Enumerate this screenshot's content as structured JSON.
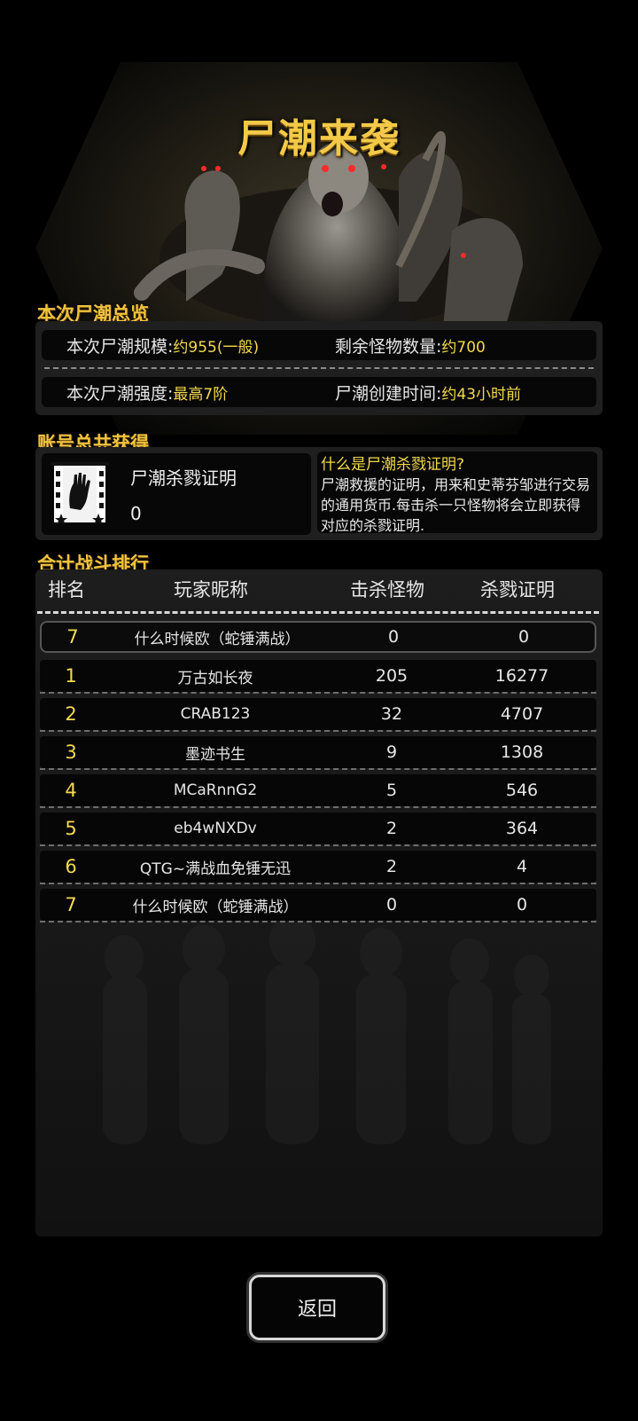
{
  "title": "尸潮来袭",
  "overview": {
    "label": "本次尸潮总览",
    "scale_label": "本次尸潮规模:",
    "scale_value": "约955(一般)",
    "remaining_label": "剩余怪物数量:",
    "remaining_value": "约700",
    "strength_label": "本次尸潮强度:",
    "strength_value": "最高7阶",
    "created_label": "尸潮创建时间:",
    "created_value": "约43小时前"
  },
  "earned": {
    "label": "账号总共获得",
    "item_name": "尸潮杀戮证明",
    "item_count": "0",
    "item_icon": "zombie-hand-ticket-icon",
    "info_title": "什么是尸潮杀戮证明?",
    "info_body": "尸潮救援的证明，用来和史蒂芬邹进行交易的通用货币.每击杀一只怪物将会立即获得对应的杀戮证明."
  },
  "ranking": {
    "label": "合计战斗排行",
    "headers": [
      "排名",
      "玩家昵称",
      "击杀怪物",
      "杀戮证明"
    ],
    "self": {
      "rank": "7",
      "name": "什么时候欧（蛇锤满战）",
      "kills": "0",
      "certs": "0"
    },
    "rows": [
      {
        "rank": "1",
        "name": "万古如长夜",
        "kills": "205",
        "certs": "16277"
      },
      {
        "rank": "2",
        "name": "CRAB123",
        "kills": "32",
        "certs": "4707"
      },
      {
        "rank": "3",
        "name": "墨迹书生",
        "kills": "9",
        "certs": "1308"
      },
      {
        "rank": "4",
        "name": "MCaRnnG2",
        "kills": "5",
        "certs": "546"
      },
      {
        "rank": "5",
        "name": "eb4wNXDv",
        "kills": "2",
        "certs": "364"
      },
      {
        "rank": "6",
        "name": "QTG~满战血免锤无迅",
        "kills": "2",
        "certs": "4"
      },
      {
        "rank": "7",
        "name": "什么时候欧（蛇锤满战）",
        "kills": "0",
        "certs": "0"
      }
    ]
  },
  "back_button": "返回",
  "colors": {
    "accent_gold": "#f0c23e",
    "value_yellow": "#f3d94e",
    "panel": "#1f1f1f",
    "row": "#060606"
  }
}
